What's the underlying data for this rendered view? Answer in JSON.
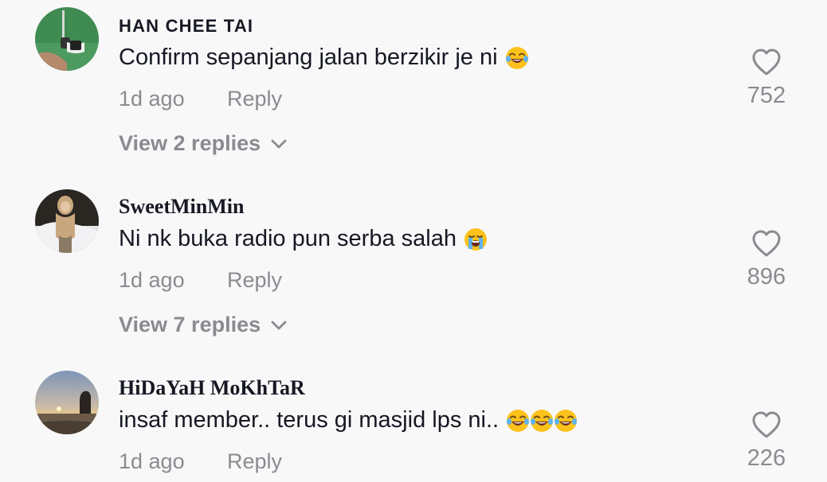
{
  "comments": [
    {
      "username": "HAN CHEE TAI",
      "text": "Confirm sepanjang jalan berzikir je ni",
      "emojis": [
        "face-with-tears-of-joy"
      ],
      "time": "1d ago",
      "reply_label": "Reply",
      "likes": "752",
      "view_replies": "View 2 replies"
    },
    {
      "username": "SweetMinMin",
      "text": "Ni nk buka radio pun serba salah",
      "emojis": [
        "loudly-crying-face"
      ],
      "time": "1d ago",
      "reply_label": "Reply",
      "likes": "896",
      "view_replies": "View 7 replies"
    },
    {
      "username": "HiDaYaH MoKhTaR",
      "text": "insaf member.. terus gi masjid lps ni..",
      "emojis": [
        "face-with-tears-of-joy",
        "face-with-tears-of-joy",
        "face-with-tears-of-joy"
      ],
      "time": "1d ago",
      "reply_label": "Reply",
      "likes": "226"
    }
  ],
  "icons": {
    "like": "heart-outline-icon",
    "expand": "chevron-down-icon"
  },
  "colors": {
    "background": "#f8f8f8",
    "primary_text": "#161823",
    "secondary_text": "#8a8b91"
  }
}
